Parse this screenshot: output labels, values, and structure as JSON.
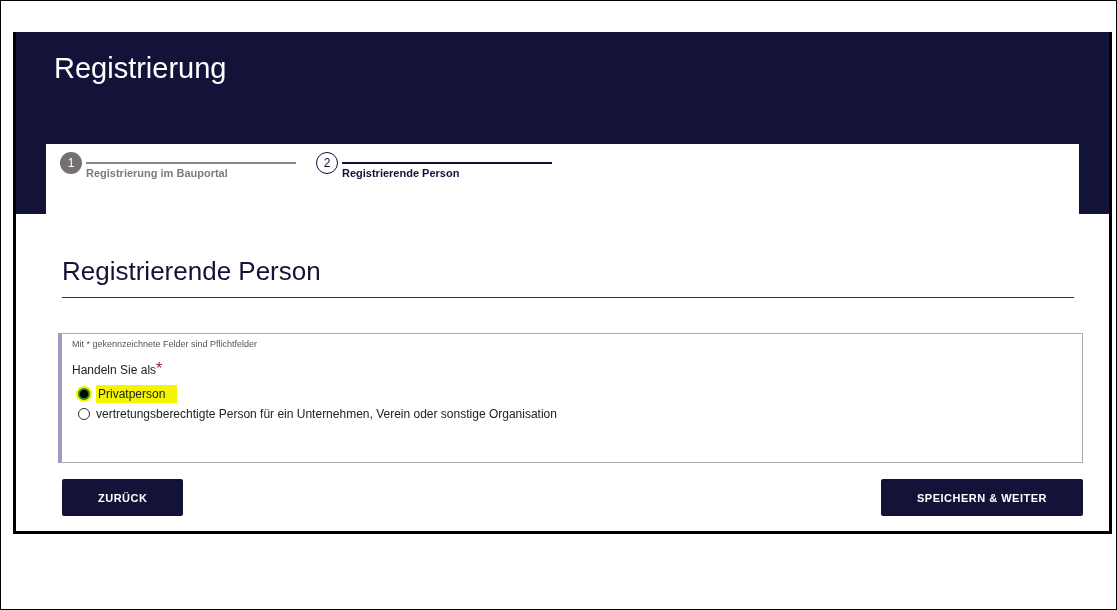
{
  "header": {
    "title": "Registrierung"
  },
  "steps": [
    {
      "number": "1",
      "label": "Registrierung im Bauportal",
      "selected": false
    },
    {
      "number": "2",
      "label": "Registrierende Person",
      "selected": true
    }
  ],
  "page_title": "Registrierende Person",
  "form": {
    "hint": "Mit * gekennzeichnete Felder sind Pflichtfelder",
    "question": "Handeln Sie als",
    "required_mark": "*",
    "options": [
      {
        "label": "Privatperson",
        "selected": true
      },
      {
        "label": "vertretungsberechtigte Person für ein Unternehmen, Verein oder sonstige Organisation",
        "selected": false
      }
    ]
  },
  "buttons": {
    "back": "ZURÜCK",
    "next": "SPEICHERN & WEITER"
  }
}
